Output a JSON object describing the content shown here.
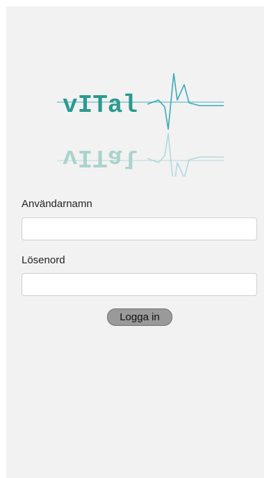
{
  "logo": {
    "text": "vITal",
    "colors": {
      "text": "#2a9a8e",
      "wave": "#3aa9b8",
      "line": "#7fc7cf",
      "reflection": "#b9dfe2"
    }
  },
  "form": {
    "username_label": "Användarnamn",
    "username_value": "",
    "password_label": "Lösenord",
    "password_value": "",
    "login_label": "Logga in"
  }
}
